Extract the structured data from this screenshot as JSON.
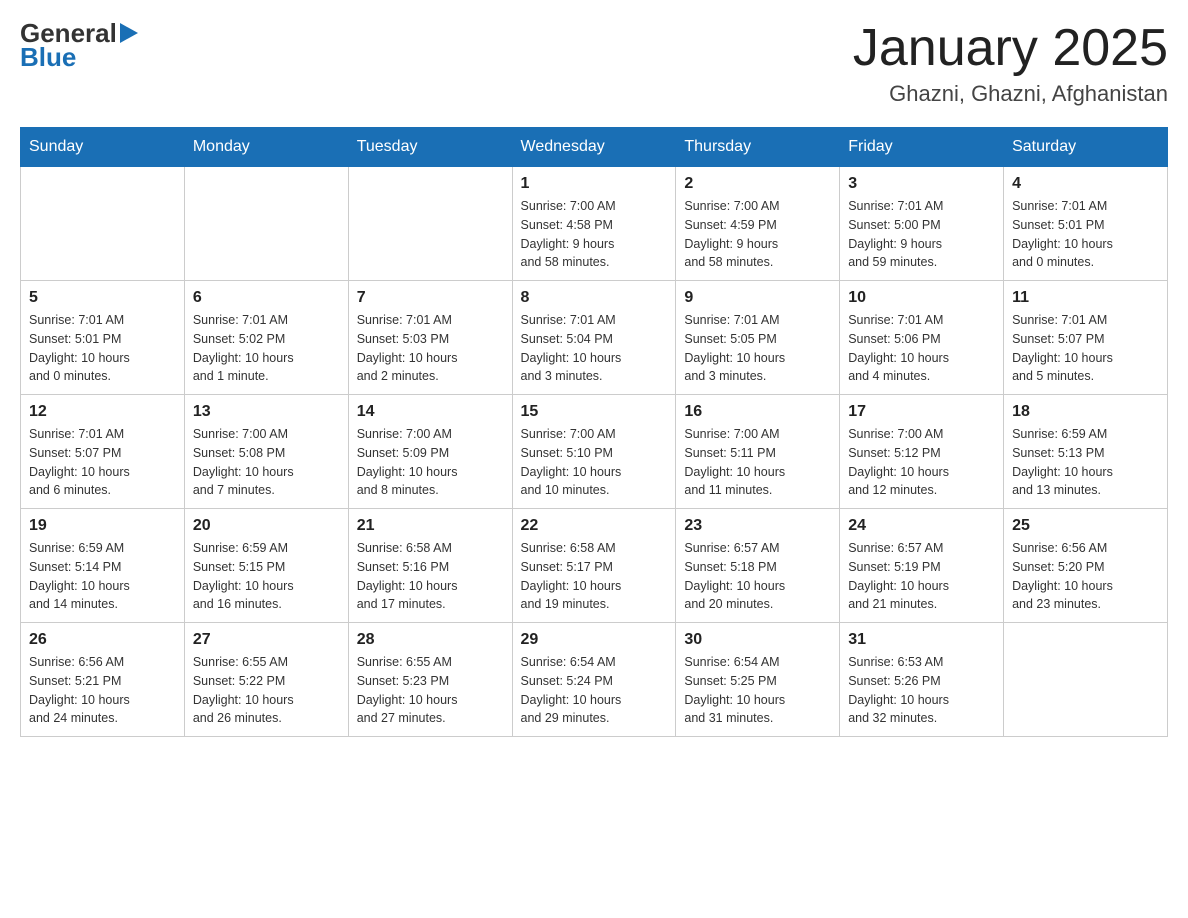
{
  "header": {
    "title": "January 2025",
    "subtitle": "Ghazni, Ghazni, Afghanistan",
    "logo_general": "General",
    "logo_blue": "Blue"
  },
  "weekdays": [
    "Sunday",
    "Monday",
    "Tuesday",
    "Wednesday",
    "Thursday",
    "Friday",
    "Saturday"
  ],
  "weeks": [
    [
      {
        "day": "",
        "info": ""
      },
      {
        "day": "",
        "info": ""
      },
      {
        "day": "",
        "info": ""
      },
      {
        "day": "1",
        "info": "Sunrise: 7:00 AM\nSunset: 4:58 PM\nDaylight: 9 hours\nand 58 minutes."
      },
      {
        "day": "2",
        "info": "Sunrise: 7:00 AM\nSunset: 4:59 PM\nDaylight: 9 hours\nand 58 minutes."
      },
      {
        "day": "3",
        "info": "Sunrise: 7:01 AM\nSunset: 5:00 PM\nDaylight: 9 hours\nand 59 minutes."
      },
      {
        "day": "4",
        "info": "Sunrise: 7:01 AM\nSunset: 5:01 PM\nDaylight: 10 hours\nand 0 minutes."
      }
    ],
    [
      {
        "day": "5",
        "info": "Sunrise: 7:01 AM\nSunset: 5:01 PM\nDaylight: 10 hours\nand 0 minutes."
      },
      {
        "day": "6",
        "info": "Sunrise: 7:01 AM\nSunset: 5:02 PM\nDaylight: 10 hours\nand 1 minute."
      },
      {
        "day": "7",
        "info": "Sunrise: 7:01 AM\nSunset: 5:03 PM\nDaylight: 10 hours\nand 2 minutes."
      },
      {
        "day": "8",
        "info": "Sunrise: 7:01 AM\nSunset: 5:04 PM\nDaylight: 10 hours\nand 3 minutes."
      },
      {
        "day": "9",
        "info": "Sunrise: 7:01 AM\nSunset: 5:05 PM\nDaylight: 10 hours\nand 3 minutes."
      },
      {
        "day": "10",
        "info": "Sunrise: 7:01 AM\nSunset: 5:06 PM\nDaylight: 10 hours\nand 4 minutes."
      },
      {
        "day": "11",
        "info": "Sunrise: 7:01 AM\nSunset: 5:07 PM\nDaylight: 10 hours\nand 5 minutes."
      }
    ],
    [
      {
        "day": "12",
        "info": "Sunrise: 7:01 AM\nSunset: 5:07 PM\nDaylight: 10 hours\nand 6 minutes."
      },
      {
        "day": "13",
        "info": "Sunrise: 7:00 AM\nSunset: 5:08 PM\nDaylight: 10 hours\nand 7 minutes."
      },
      {
        "day": "14",
        "info": "Sunrise: 7:00 AM\nSunset: 5:09 PM\nDaylight: 10 hours\nand 8 minutes."
      },
      {
        "day": "15",
        "info": "Sunrise: 7:00 AM\nSunset: 5:10 PM\nDaylight: 10 hours\nand 10 minutes."
      },
      {
        "day": "16",
        "info": "Sunrise: 7:00 AM\nSunset: 5:11 PM\nDaylight: 10 hours\nand 11 minutes."
      },
      {
        "day": "17",
        "info": "Sunrise: 7:00 AM\nSunset: 5:12 PM\nDaylight: 10 hours\nand 12 minutes."
      },
      {
        "day": "18",
        "info": "Sunrise: 6:59 AM\nSunset: 5:13 PM\nDaylight: 10 hours\nand 13 minutes."
      }
    ],
    [
      {
        "day": "19",
        "info": "Sunrise: 6:59 AM\nSunset: 5:14 PM\nDaylight: 10 hours\nand 14 minutes."
      },
      {
        "day": "20",
        "info": "Sunrise: 6:59 AM\nSunset: 5:15 PM\nDaylight: 10 hours\nand 16 minutes."
      },
      {
        "day": "21",
        "info": "Sunrise: 6:58 AM\nSunset: 5:16 PM\nDaylight: 10 hours\nand 17 minutes."
      },
      {
        "day": "22",
        "info": "Sunrise: 6:58 AM\nSunset: 5:17 PM\nDaylight: 10 hours\nand 19 minutes."
      },
      {
        "day": "23",
        "info": "Sunrise: 6:57 AM\nSunset: 5:18 PM\nDaylight: 10 hours\nand 20 minutes."
      },
      {
        "day": "24",
        "info": "Sunrise: 6:57 AM\nSunset: 5:19 PM\nDaylight: 10 hours\nand 21 minutes."
      },
      {
        "day": "25",
        "info": "Sunrise: 6:56 AM\nSunset: 5:20 PM\nDaylight: 10 hours\nand 23 minutes."
      }
    ],
    [
      {
        "day": "26",
        "info": "Sunrise: 6:56 AM\nSunset: 5:21 PM\nDaylight: 10 hours\nand 24 minutes."
      },
      {
        "day": "27",
        "info": "Sunrise: 6:55 AM\nSunset: 5:22 PM\nDaylight: 10 hours\nand 26 minutes."
      },
      {
        "day": "28",
        "info": "Sunrise: 6:55 AM\nSunset: 5:23 PM\nDaylight: 10 hours\nand 27 minutes."
      },
      {
        "day": "29",
        "info": "Sunrise: 6:54 AM\nSunset: 5:24 PM\nDaylight: 10 hours\nand 29 minutes."
      },
      {
        "day": "30",
        "info": "Sunrise: 6:54 AM\nSunset: 5:25 PM\nDaylight: 10 hours\nand 31 minutes."
      },
      {
        "day": "31",
        "info": "Sunrise: 6:53 AM\nSunset: 5:26 PM\nDaylight: 10 hours\nand 32 minutes."
      },
      {
        "day": "",
        "info": ""
      }
    ]
  ]
}
